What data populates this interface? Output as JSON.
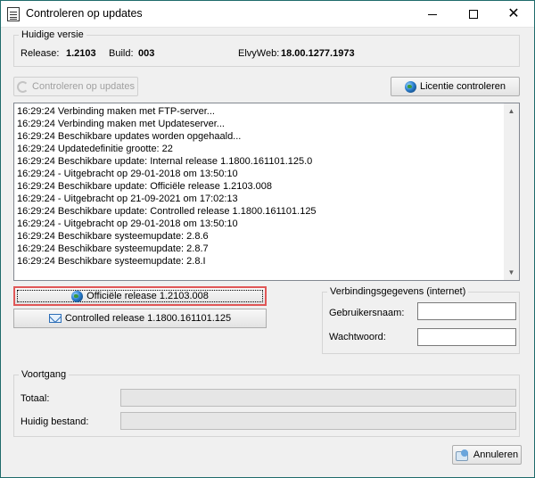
{
  "window": {
    "title": "Controleren op updates"
  },
  "version": {
    "legend": "Huidige versie",
    "release_label": "Release:",
    "release_value": "1.2103",
    "build_label": "Build:",
    "build_value": "003",
    "elvyweb_label": "ElvyWeb:",
    "elvyweb_value": "18.00.1277.1973"
  },
  "toolbar": {
    "check_updates_label": "Controleren op updates",
    "check_license_label": "Licentie controleren"
  },
  "log": [
    "16:29:24 Verbinding maken met FTP-server...",
    "16:29:24 Verbinding maken met Updateserver...",
    "16:29:24 Beschikbare updates worden opgehaald...",
    "16:29:24 Updatedefinitie grootte: 22",
    "16:29:24 Beschikbare update: Internal release 1.1800.161101.125.0",
    "16:29:24 - Uitgebracht op 29-01-2018 om 13:50:10",
    "16:29:24 Beschikbare update: Officiële release 1.2103.008",
    "16:29:24 - Uitgebracht op 21-09-2021 om 17:02:13",
    "16:29:24 Beschikbare update: Controlled release 1.1800.161101.125",
    "16:29:24 - Uitgebracht op 29-01-2018 om 13:50:10",
    "16:29:24 Beschikbare systeemupdate: 2.8.6",
    "16:29:24 Beschikbare systeemupdate: 2.8.7",
    "16:29:24 Beschikbare systeemupdate: 2.8.I"
  ],
  "releases": {
    "official_label": "Officiële release 1.2103.008",
    "controlled_label": "Controlled release 1.1800.161101.125"
  },
  "connection": {
    "legend": "Verbindingsgegevens (internet)",
    "username_label": "Gebruikersnaam:",
    "username_value": "",
    "password_label": "Wachtwoord:",
    "password_value": ""
  },
  "progress": {
    "legend": "Voortgang",
    "total_label": "Totaal:",
    "total_fraction": 0,
    "current_file_label": "Huidig bestand:",
    "current_file_fraction": 0
  },
  "footer": {
    "cancel_label": "Annuleren"
  },
  "icons": {
    "app": "document-icon",
    "check_updates": "refresh-icon",
    "license": "globe-icon",
    "official_release": "globe-icon",
    "controlled_release": "mail-icon",
    "cancel": "cancel-icon"
  },
  "colors": {
    "highlight_border": "#e05757",
    "window_bg": "#f0f0f0"
  }
}
